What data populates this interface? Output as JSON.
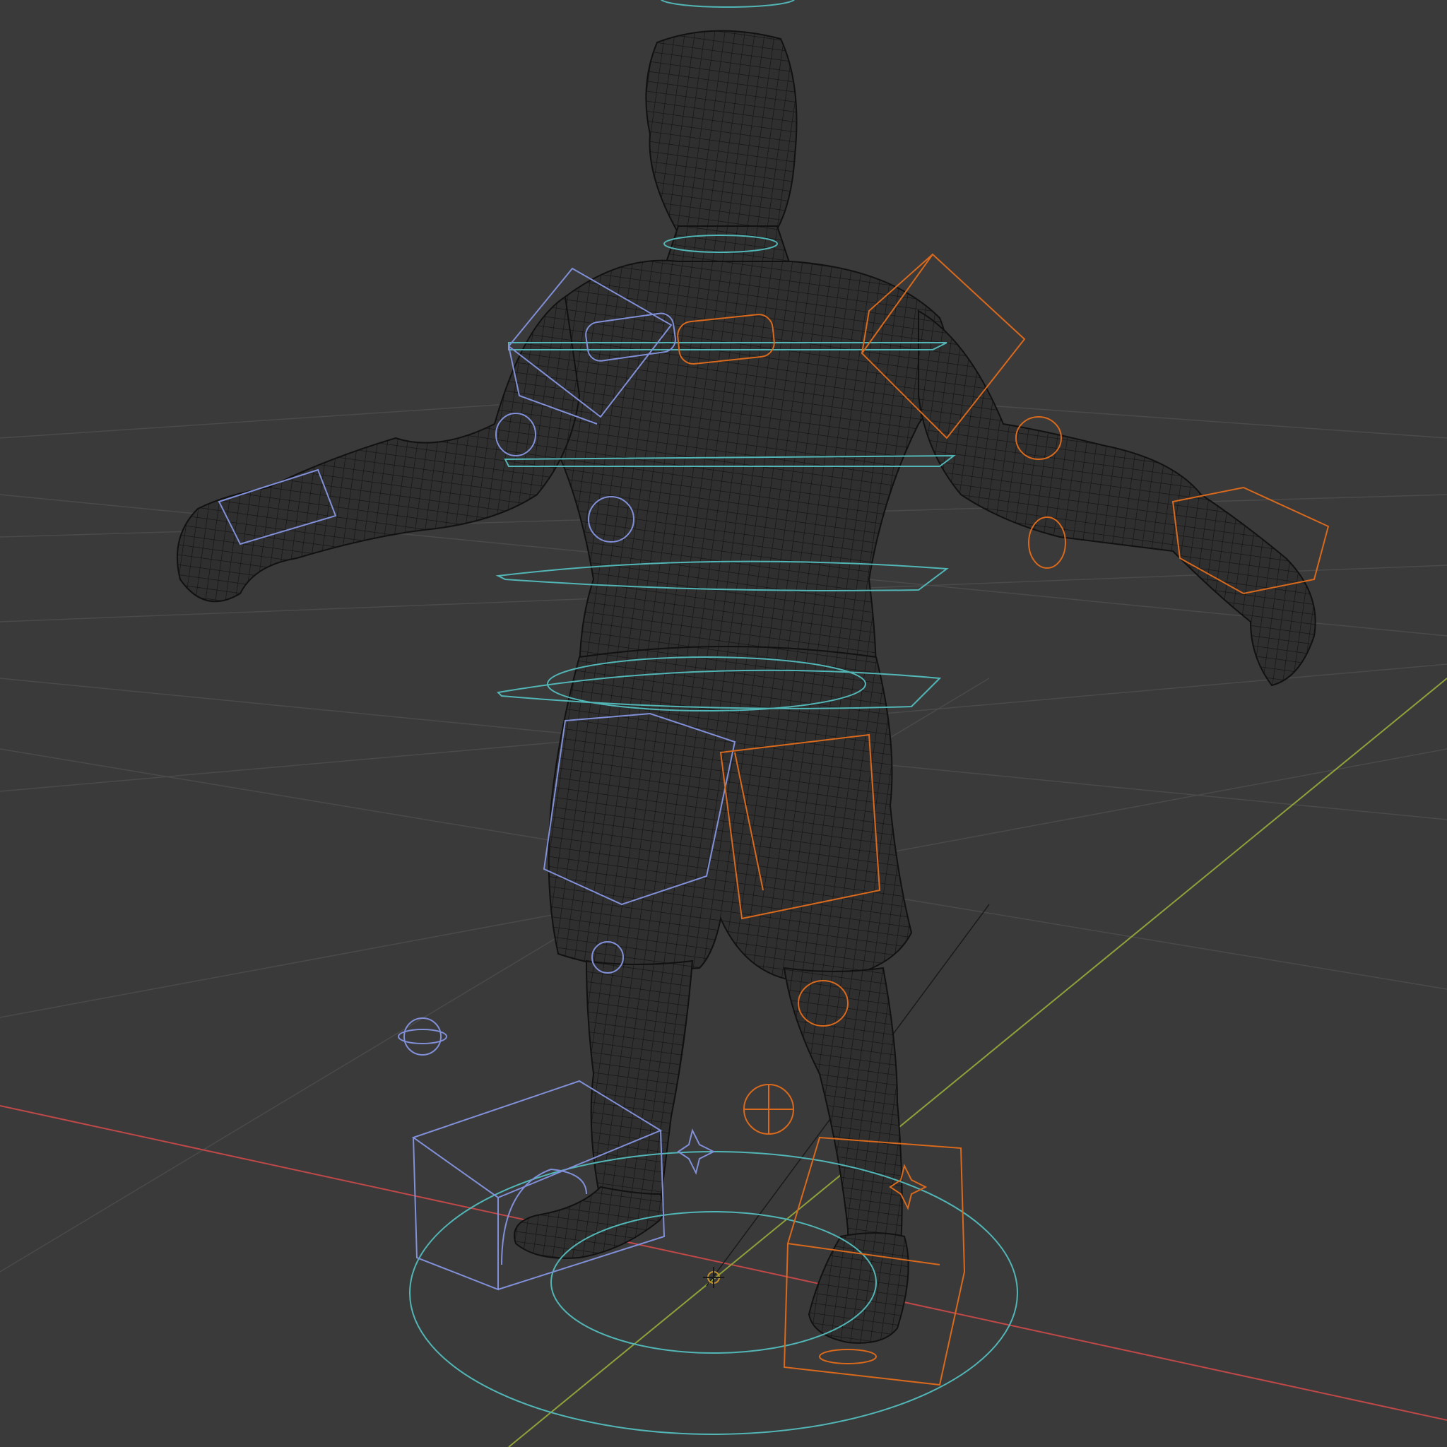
{
  "viewport": {
    "mode": "wireframe",
    "background": "#3a3a3a",
    "floor_grid": true
  },
  "colors": {
    "x_axis": "#c04848",
    "y_axis": "#8ea23a",
    "mesh_wire": "#141414",
    "controls_center": "#52b6b6",
    "controls_left": "#8190d8",
    "controls_right": "#d9691c"
  },
  "scene": {
    "mesh": "humanoid-character",
    "rig": "armature-controls"
  }
}
